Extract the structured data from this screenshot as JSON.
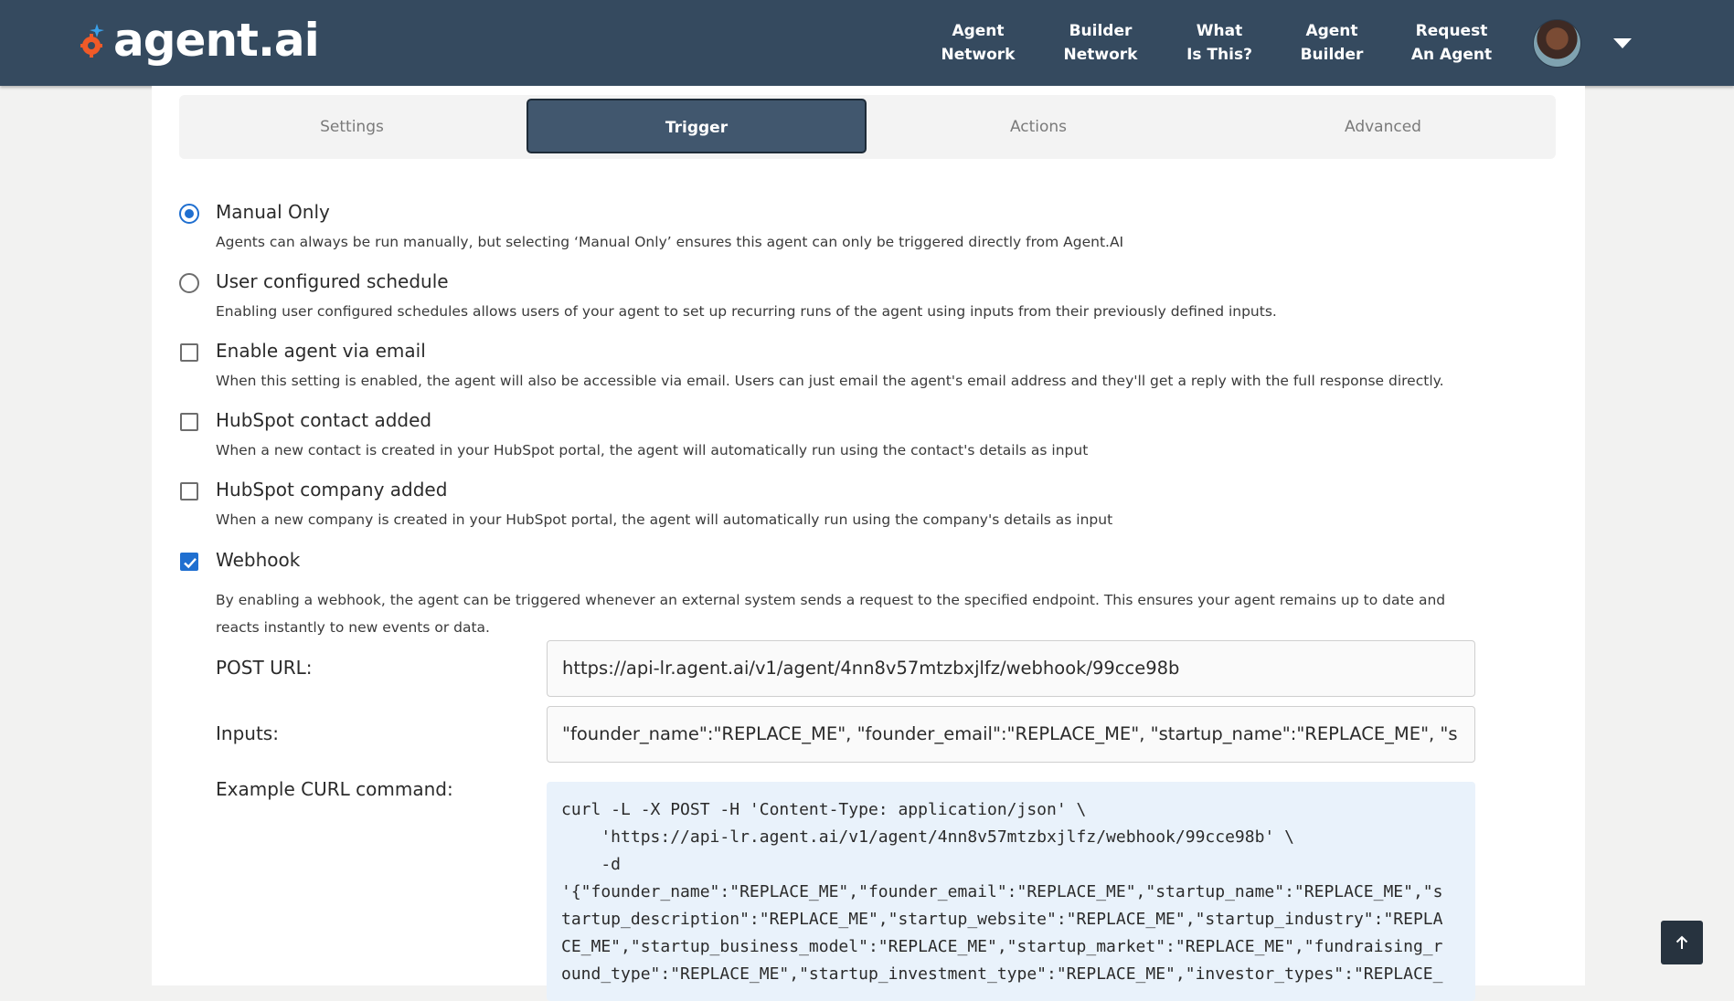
{
  "header": {
    "logo_text": "agent.ai",
    "nav": [
      {
        "line1": "Agent",
        "line2": "Network"
      },
      {
        "line1": "Builder",
        "line2": "Network"
      },
      {
        "line1": "What",
        "line2": "Is This?"
      },
      {
        "line1": "Agent",
        "line2": "Builder"
      },
      {
        "line1": "Request",
        "line2": "An Agent"
      }
    ]
  },
  "tabs": [
    "Settings",
    "Trigger",
    "Actions",
    "Advanced"
  ],
  "active_tab": "Trigger",
  "options": {
    "manual": {
      "label": "Manual Only",
      "desc": "Agents can always be run manually, but selecting ‘Manual Only’ ensures this agent can only be triggered directly from Agent.AI",
      "selected": true
    },
    "schedule": {
      "label": "User configured schedule",
      "desc": "Enabling user configured schedules allows users of your agent to set up recurring runs of the agent using inputs from their previously defined inputs.",
      "selected": false
    },
    "email": {
      "label": "Enable agent via email",
      "desc": "When this setting is enabled, the agent will also be accessible via email. Users can just email the agent's email address and they'll get a reply with the full response directly.",
      "checked": false
    },
    "hubspot_contact": {
      "label": "HubSpot contact added",
      "desc": "When a new contact is created in your HubSpot portal, the agent will automatically run using the contact's details as input",
      "checked": false
    },
    "hubspot_company": {
      "label": "HubSpot company added",
      "desc": "When a new company is created in your HubSpot portal, the agent will automatically run using the company's details as input",
      "checked": false
    },
    "webhook": {
      "label": "Webhook",
      "desc": "By enabling a webhook, the agent can be triggered whenever an external system sends a request to the specified endpoint. This ensures your agent remains up to date and reacts instantly to new events or data.",
      "checked": true
    }
  },
  "webhook": {
    "post_url_label": "POST URL:",
    "post_url_value": "https://api-lr.agent.ai/v1/agent/4nn8v57mtzbxjlfz/webhook/99cce98b",
    "inputs_label": "Inputs:",
    "inputs_value": "\"founder_name\":\"REPLACE_ME\", \"founder_email\":\"REPLACE_ME\", \"startup_name\":\"REPLACE_ME\", \"s",
    "curl_label": "Example CURL command:",
    "curl_code": "curl -L -X POST -H 'Content-Type: application/json' \\\n    'https://api-lr.agent.ai/v1/agent/4nn8v57mtzbxjlfz/webhook/99cce98b' \\\n    -d\n'{\"founder_name\":\"REPLACE_ME\",\"founder_email\":\"REPLACE_ME\",\"startup_name\":\"REPLACE_ME\",\"s\ntartup_description\":\"REPLACE_ME\",\"startup_website\":\"REPLACE_ME\",\"startup_industry\":\"REPLA\nCE_ME\",\"startup_business_model\":\"REPLACE_ME\",\"startup_market\":\"REPLACE_ME\",\"fundraising_r\nound_type\":\"REPLACE_ME\",\"startup_investment_type\":\"REPLACE_ME\",\"investor_types\":\"REPLACE_"
  },
  "icons": {
    "logo": "agent-ai-logo-icon",
    "caret": "chevron-down-icon",
    "scroll_top": "arrow-up-icon"
  },
  "colors": {
    "header_bg": "#354a5f",
    "active_tab_bg": "#41576e",
    "accent_blue": "#1f6fd0",
    "code_bg": "#e9f2fb"
  }
}
